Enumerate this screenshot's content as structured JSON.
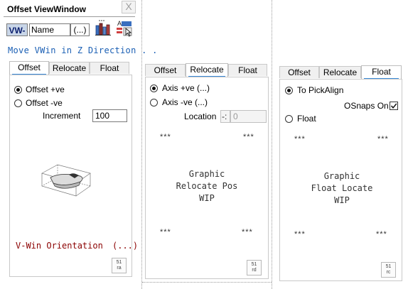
{
  "panel1": {
    "title": "Offset ViewWindow",
    "close_label": "X",
    "vw_label": "VW-",
    "name_value": "Name",
    "dots_label": "(...)",
    "header": "Move VWin in Z Direction . .",
    "tabs": [
      "Offset",
      "Relocate",
      "Float"
    ],
    "active_tab": "Offset",
    "radio1": "Offset +ve",
    "radio2": "Offset -ve",
    "selected_radio": "Offset +ve",
    "increment_label": "Increment",
    "increment_value": "100",
    "orientation_label": "V-Win Orientation",
    "orientation_btn": "(...)",
    "corner_top": "51",
    "corner_bottom": "ra"
  },
  "panel2": {
    "tabs": [
      "Offset",
      "Relocate",
      "Float"
    ],
    "active_tab": "Relocate",
    "radio1": "Axis +ve (...)",
    "radio2": "Axis -ve (...)",
    "selected_radio": "Axis +ve (...)",
    "location_label": "Location",
    "location_sign": "-:",
    "location_value": "0",
    "stars": "***",
    "wip_line1": "Graphic",
    "wip_line2": "Relocate Pos",
    "wip_line3": "WIP",
    "corner_top": "51",
    "corner_bottom": "rd"
  },
  "panel3": {
    "tabs": [
      "Offset",
      "Relocate",
      "Float"
    ],
    "active_tab": "Float",
    "radio1": "To PickAlign",
    "radio2": "Float",
    "selected_radio": "To PickAlign",
    "osnaps_label": "OSnaps On",
    "osnaps_checked": true,
    "stars": "***",
    "wip_line1": "Graphic",
    "wip_line2": "Float Locate",
    "wip_line3": "WIP",
    "corner_top": "51",
    "corner_bottom": "rc"
  },
  "colors": {
    "accent_blue": "#1a5fb4",
    "tab_underline": "#3b8bd9",
    "orientation_red": "#8b0000"
  }
}
